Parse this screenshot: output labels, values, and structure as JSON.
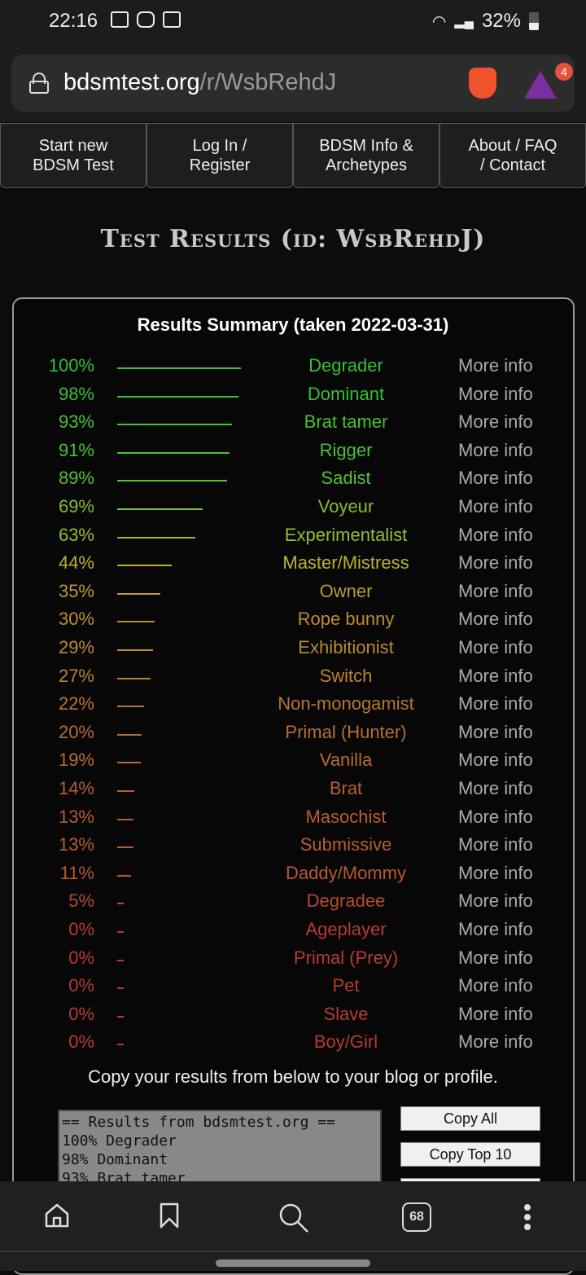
{
  "status_bar": {
    "time": "22:16",
    "battery": "32%"
  },
  "browser": {
    "url_host": "bdsmtest.org",
    "url_path": "/r/WsbRehdJ",
    "shields_badge": "4",
    "tab_count": "68"
  },
  "nav": [
    {
      "label": "Start new\nBDSM Test"
    },
    {
      "label": "Log In /\nRegister"
    },
    {
      "label": "BDSM Info &\nArchetypes"
    },
    {
      "label": "About / FAQ\n/ Contact"
    }
  ],
  "page_title": "Test Results (id: WsbRehdJ)",
  "summary_heading": "Results Summary (taken 2022-03-31)",
  "more_info_label": "More info",
  "results": [
    {
      "pct": 100,
      "label": "100%",
      "name": "Degrader"
    },
    {
      "pct": 98,
      "label": "98%",
      "name": "Dominant"
    },
    {
      "pct": 93,
      "label": "93%",
      "name": "Brat tamer"
    },
    {
      "pct": 91,
      "label": "91%",
      "name": "Rigger"
    },
    {
      "pct": 89,
      "label": "89%",
      "name": "Sadist"
    },
    {
      "pct": 69,
      "label": "69%",
      "name": "Voyeur"
    },
    {
      "pct": 63,
      "label": "63%",
      "name": "Experimentalist"
    },
    {
      "pct": 44,
      "label": "44%",
      "name": "Master/Mistress"
    },
    {
      "pct": 35,
      "label": "35%",
      "name": "Owner"
    },
    {
      "pct": 30,
      "label": "30%",
      "name": "Rope bunny"
    },
    {
      "pct": 29,
      "label": "29%",
      "name": "Exhibitionist"
    },
    {
      "pct": 27,
      "label": "27%",
      "name": "Switch"
    },
    {
      "pct": 22,
      "label": "22%",
      "name": "Non-monogamist"
    },
    {
      "pct": 20,
      "label": "20%",
      "name": "Primal (Hunter)"
    },
    {
      "pct": 19,
      "label": "19%",
      "name": "Vanilla"
    },
    {
      "pct": 14,
      "label": "14%",
      "name": "Brat"
    },
    {
      "pct": 13,
      "label": "13%",
      "name": "Masochist"
    },
    {
      "pct": 13,
      "label": "13%",
      "name": "Submissive"
    },
    {
      "pct": 11,
      "label": "11%",
      "name": "Daddy/Mommy"
    },
    {
      "pct": 5,
      "label": "5%",
      "name": "Degradee"
    },
    {
      "pct": 0,
      "label": "0%",
      "name": "Ageplayer"
    },
    {
      "pct": 0,
      "label": "0%",
      "name": "Primal (Prey)"
    },
    {
      "pct": 0,
      "label": "0%",
      "name": "Pet"
    },
    {
      "pct": 0,
      "label": "0%",
      "name": "Slave"
    },
    {
      "pct": 0,
      "label": "0%",
      "name": "Boy/Girl"
    }
  ],
  "copy_instructions": "Copy your results from below to your blog or profile.",
  "copy_textarea": "== Results from bdsmtest.org ==\n100% Degrader\n98% Dominant\n93% Brat tamer",
  "buttons": {
    "copy_all": "Copy All",
    "copy_top10": "Copy Top 10"
  }
}
